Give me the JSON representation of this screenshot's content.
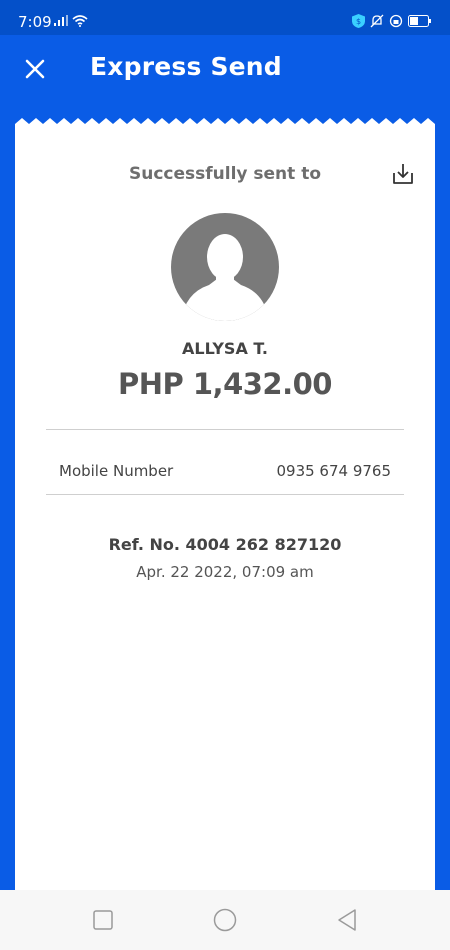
{
  "status_bar": {
    "time": "7:09",
    "left_icons": [
      "signal-icon",
      "wifi-icon"
    ],
    "right_icons": [
      "vpn-shield-icon",
      "mute-bell-icon",
      "data-saver-icon",
      "battery-icon"
    ]
  },
  "header": {
    "title": "Express Send",
    "close_icon": "close-icon"
  },
  "receipt": {
    "success_label": "Successfully sent to",
    "download_icon": "download-icon",
    "recipient_name": "ALLYSA T.",
    "amount": "PHP 1,432.00",
    "details": [
      {
        "label": "Mobile Number",
        "value": "0935 674 9765"
      }
    ],
    "reference": "Ref. No. 4004 262 827120",
    "date": "Apr. 22 2022, 07:09 am"
  },
  "nav_bar": {
    "buttons": [
      "recents-square-icon",
      "home-circle-icon",
      "back-triangle-icon"
    ]
  },
  "colors": {
    "primary_blue": "#0a5ce6",
    "status_blue": "#0450c9",
    "avatar_gray": "#7a7a7a",
    "text_dark": "#444444"
  }
}
